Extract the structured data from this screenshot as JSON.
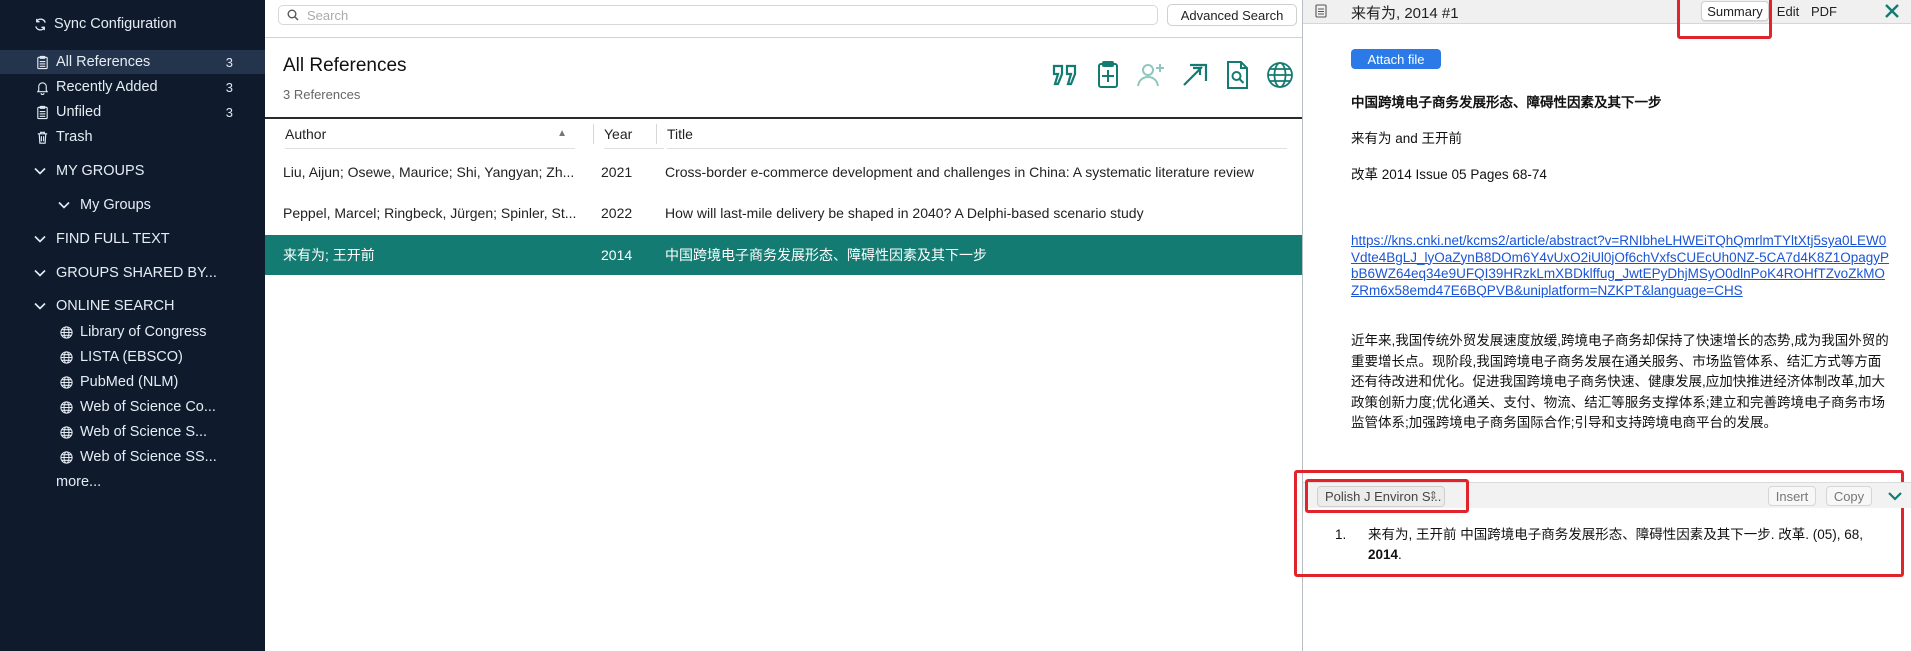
{
  "sidebar": {
    "sync": "Sync Configuration",
    "library": [
      {
        "label": "All References",
        "count": "3",
        "icon": "clipboard-icon"
      },
      {
        "label": "Recently Added",
        "count": "3",
        "icon": "bell-icon"
      },
      {
        "label": "Unfiled",
        "count": "3",
        "icon": "clipboard-icon"
      },
      {
        "label": "Trash",
        "count": "",
        "icon": "trash-icon"
      }
    ],
    "sections": {
      "my_groups": "MY GROUPS",
      "my_groups_child": "My Groups",
      "find_full_text": "FIND FULL TEXT",
      "groups_shared": "GROUPS SHARED BY...",
      "online_search": "ONLINE SEARCH"
    },
    "online": [
      "Library of Congress",
      "LISTA (EBSCO)",
      "PubMed (NLM)",
      "Web of Science Co...",
      "Web of Science S...",
      "Web of Science SS..."
    ],
    "more": "more..."
  },
  "middle": {
    "search_placeholder": "Search",
    "advanced_search": "Advanced Search",
    "title": "All References",
    "subtitle": "3 References",
    "columns": {
      "author": "Author",
      "year": "Year",
      "title": "Title"
    },
    "rows": [
      {
        "author": "Liu, Aijun; Osewe, Maurice; Shi, Yangyan; Zh...",
        "year": "2021",
        "title": "Cross-border e-commerce development and challenges in China: A systematic literature review"
      },
      {
        "author": "Peppel, Marcel; Ringbeck, Jürgen; Spinler, St...",
        "year": "2022",
        "title": "How will last-mile delivery be shaped in 2040? A Delphi-based scenario study"
      },
      {
        "author": "来有为; 王开前",
        "year": "2014",
        "title": "中国跨境电子商务发展形态、障碍性因素及其下一步"
      }
    ]
  },
  "right": {
    "ref_title": "来有为, 2014 #1",
    "tabs": {
      "summary": "Summary",
      "edit": "Edit",
      "pdf": "PDF"
    },
    "attach": "Attach file",
    "article_title": "中国跨境电子商务发展形态、障碍性因素及其下一步",
    "authors": "来有为 and 王开前",
    "journal_line": "改革 2014 Issue 05 Pages 68-74",
    "url": "https://kns.cnki.net/kcms2/article/abstract?v=RNIbheLHWEiTQhQmrlmTYltXtj5sya0LEW0Vdte4BgLJ_lyOaZynB8DOm6Y4vUxO2iUl0jOf6chVxfsCUEcUh0NZ-5CA7d4K8Z1OpagyPbB6WZ64eq34e9UFQI39HRzkLmXBDklffug_JwtEPyDhjMSyO0dlnPoK4ROHfTZvoZkMOZRm6x58emd47E6BQPVB&uniplatform=NZKPT&language=CHS",
    "abstract": "近年来,我国传统外贸发展速度放缓,跨境电子商务却保持了快速增长的态势,成为我国外贸的重要增长点。现阶段,我国跨境电子商务发展在通关服务、市场监管体系、结汇方式等方面还有待改进和优化。促进我国跨境电子商务快速、健康发展,应加快推进经济体制改革,加大政策创新力度;优化通关、支付、物流、结汇等服务支撑体系;建立和完善跨境电子商务市场监管体系;加强跨境电子商务国际合作;引导和支持跨境电商平台的发展。",
    "style": "Polish J Environ S...",
    "insert": "Insert",
    "copy": "Copy",
    "citation_num": "1.",
    "citation_text": "来有为, 王开前 中国跨境电子商务发展形态、障碍性因素及其下一步. 改革. (05), 68,",
    "citation_year": "2014",
    "citation_end": "."
  },
  "colors": {
    "sidebar_bg": "#0f1b2d",
    "selected_row": "#137b72",
    "teal_icon": "#137b72",
    "link": "#1a55d6",
    "highlight": "#e0242c"
  }
}
